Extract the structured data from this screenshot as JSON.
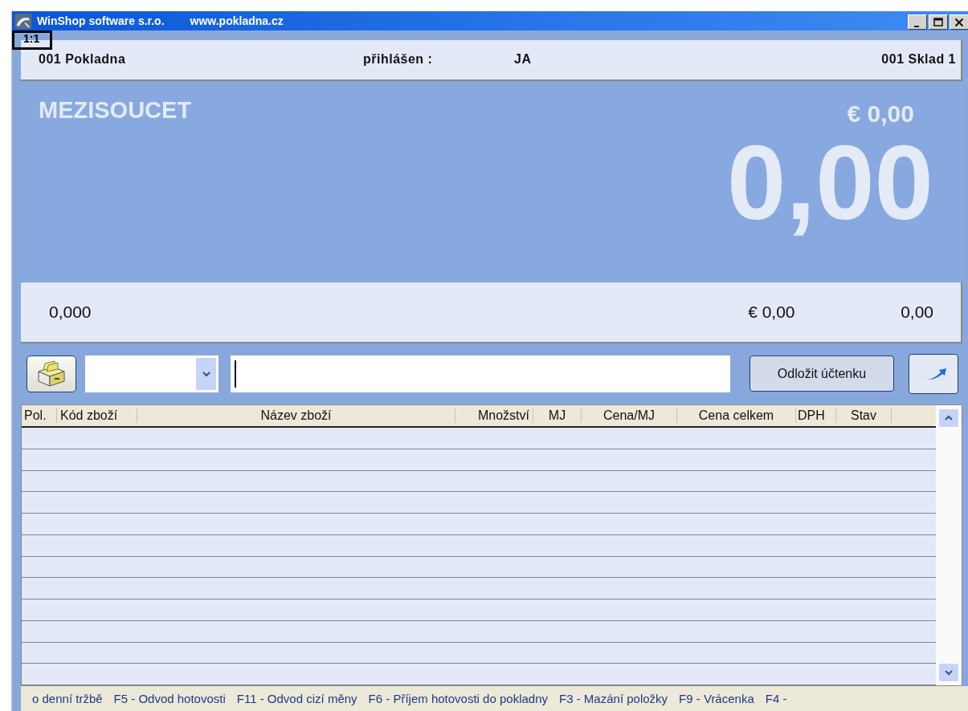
{
  "window": {
    "title_parts": [
      "WinShop software s.r.o.",
      "www.pokladna.cz"
    ]
  },
  "zoom_badge": "1:1",
  "header": {
    "register": "001 Pokladna",
    "logged_label": "přihlášen :",
    "user": "JA",
    "store": "001 Sklad 1"
  },
  "display": {
    "label": "MEZISOUCET",
    "euro_total": "€ 0,00",
    "total": "0,00"
  },
  "summary": {
    "quantity": "0,000",
    "euro": "€ 0,00",
    "amount": "0,00"
  },
  "toolbar": {
    "button": "Odložit účtenku"
  },
  "table": {
    "columns": [
      "Pol.",
      "Kód zboží",
      "Název zboží",
      "Množství",
      "MJ",
      "Cena/MJ",
      "Cena celkem",
      "DPH",
      "Stav"
    ]
  },
  "status_bar": {
    "items": [
      "o denní tržbě",
      "F5 - Odvod hotovosti",
      "F11 -  Odvod cizí měny",
      "F6 - Příjem hotovosti do pokladny",
      "F3 - Mazání položky",
      "F9 - Vrácenka",
      "F4 -"
    ]
  }
}
